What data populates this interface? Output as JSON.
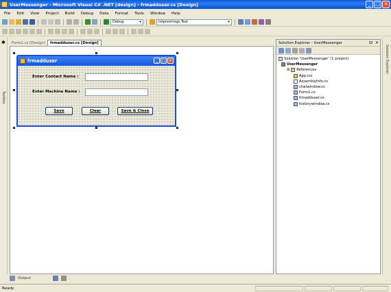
{
  "window": {
    "title": "UserMessenger - Microsoft Visual C# .NET [design] - frmadduser.cs [Design]",
    "min_glyph": "_",
    "max_glyph": "□",
    "close_glyph": "✕"
  },
  "menu": [
    "File",
    "Edit",
    "View",
    "Project",
    "Build",
    "Debug",
    "Data",
    "Format",
    "Tools",
    "Window",
    "Help"
  ],
  "toolbar": {
    "config_value": "Debug",
    "find_value": "txtprevmsgs.Text"
  },
  "left_strip_label": "Toolbox",
  "right_strip_label": "Solution Explorer",
  "doc_tabs": [
    {
      "label": "Form1.cs [Design]"
    },
    {
      "label": "frmadduser.cs [Design]"
    }
  ],
  "form": {
    "title": "frmadduser",
    "contact_label": "Enter Contact Name :",
    "machine_label": "Enter Machine Name :",
    "contact_value": "",
    "machine_value": "",
    "buttons": {
      "save": "Save",
      "clear": "Clear",
      "save_close": "Save & Close"
    }
  },
  "solution_explorer": {
    "title": "Solution Explorer - UserMessenger",
    "pin_glyph": "⊟",
    "close_glyph": "✕",
    "solution": "Solution 'UserMessenger' (1 project)",
    "project": "UserMessenger",
    "items": [
      "References",
      "App.ico",
      "AssemblyInfo.cs",
      "chatwindow.cs",
      "Form1.cs",
      "frmadduser.cs",
      "historywindow.cs"
    ]
  },
  "output": {
    "label": "Output"
  },
  "status": {
    "text": "Ready"
  },
  "colors": {
    "title_bar": "#0a5bd8",
    "form_border": "#1c4fcf",
    "chrome": "#ece9d8"
  }
}
